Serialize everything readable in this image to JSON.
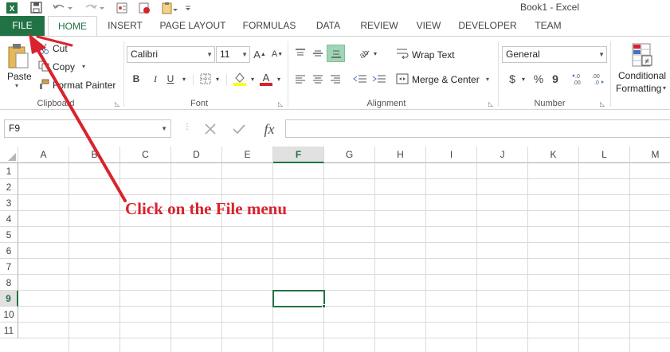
{
  "window": {
    "title": "Book1 - Excel"
  },
  "tabs": [
    {
      "label": "FILE"
    },
    {
      "label": "HOME"
    },
    {
      "label": "INSERT"
    },
    {
      "label": "PAGE LAYOUT"
    },
    {
      "label": "FORMULAS"
    },
    {
      "label": "DATA"
    },
    {
      "label": "REVIEW"
    },
    {
      "label": "VIEW"
    },
    {
      "label": "DEVELOPER"
    },
    {
      "label": "TEAM"
    }
  ],
  "ribbon": {
    "clipboard": {
      "label": "Clipboard",
      "paste": "Paste",
      "cut": "Cut",
      "copy": "Copy",
      "format_painter": "Format Painter"
    },
    "font": {
      "label": "Font",
      "font_name": "Calibri",
      "font_size": "11",
      "bold": "B",
      "italic": "I",
      "underline": "U"
    },
    "alignment": {
      "label": "Alignment",
      "wrap_text": "Wrap Text",
      "merge_center": "Merge & Center"
    },
    "number": {
      "label": "Number",
      "format": "General",
      "currency": "$",
      "percent": "%",
      "comma": "9"
    },
    "styles": {
      "conditional_line1": "Conditional",
      "conditional_line2": "Formatting"
    }
  },
  "formula_bar": {
    "name_box": "F9",
    "fx": "fx",
    "value": ""
  },
  "grid": {
    "columns": [
      "A",
      "B",
      "C",
      "D",
      "E",
      "F",
      "G",
      "H",
      "I",
      "J",
      "K",
      "L",
      "M"
    ],
    "rows": [
      "1",
      "2",
      "3",
      "4",
      "5",
      "6",
      "7",
      "8",
      "9",
      "10",
      "11"
    ],
    "active_column": "F",
    "active_row": "9"
  },
  "annotation": {
    "text": "Click on the File menu",
    "color": "#d9232d"
  },
  "colors": {
    "excel_green": "#217346",
    "annotation_red": "#d9232d"
  }
}
